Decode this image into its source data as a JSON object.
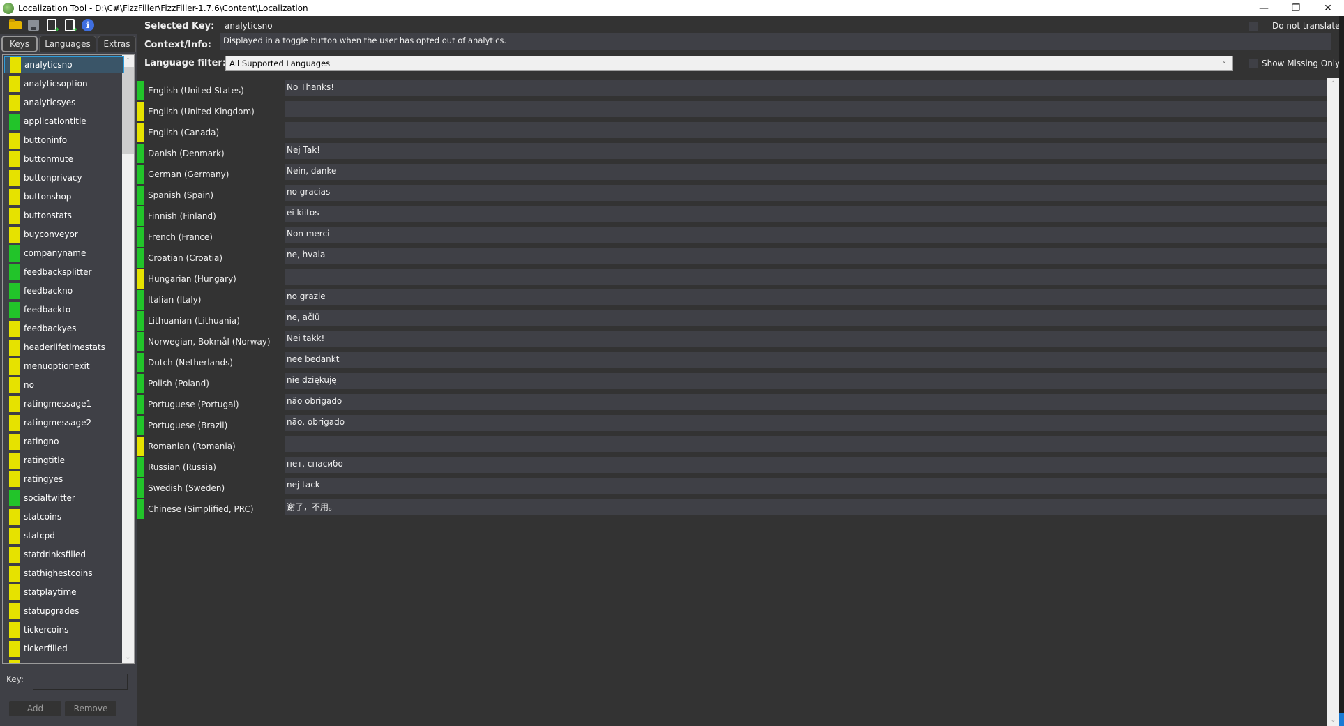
{
  "window": {
    "title": "Localization Tool - D:\\C#\\FizzFiller\\FizzFiller-1.7.6\\Content\\Localization",
    "minimize": "—",
    "maximize": "❐",
    "close": "✕"
  },
  "toolbar": {
    "icons": [
      "folder-open-icon",
      "save-icon",
      "import-file-icon",
      "export-file-icon",
      "info-icon"
    ],
    "info_glyph": "i"
  },
  "tabs": [
    {
      "label": "Keys",
      "active": true
    },
    {
      "label": "Languages",
      "active": false
    },
    {
      "label": "Extras",
      "active": false
    }
  ],
  "colors": {
    "complete": "#22c42a",
    "missing": "#e6e200",
    "selected_bg": "#3a5568",
    "selected_border": "#2e9bd8"
  },
  "keys": [
    {
      "name": "analyticsno",
      "status": "missing",
      "selected": true
    },
    {
      "name": "analyticsoption",
      "status": "missing"
    },
    {
      "name": "analyticsyes",
      "status": "missing"
    },
    {
      "name": "applicationtitle",
      "status": "complete"
    },
    {
      "name": "buttoninfo",
      "status": "missing"
    },
    {
      "name": "buttonmute",
      "status": "missing"
    },
    {
      "name": "buttonprivacy",
      "status": "missing"
    },
    {
      "name": "buttonshop",
      "status": "missing"
    },
    {
      "name": "buttonstats",
      "status": "missing"
    },
    {
      "name": "buyconveyor",
      "status": "missing"
    },
    {
      "name": "companyname",
      "status": "complete"
    },
    {
      "name": "feedbacksplitter",
      "status": "complete"
    },
    {
      "name": "feedbackno",
      "status": "complete"
    },
    {
      "name": "feedbackto",
      "status": "complete"
    },
    {
      "name": "feedbackyes",
      "status": "missing"
    },
    {
      "name": "headerlifetimestats",
      "status": "missing"
    },
    {
      "name": "menuoptionexit",
      "status": "missing"
    },
    {
      "name": "no",
      "status": "missing"
    },
    {
      "name": "ratingmessage1",
      "status": "missing"
    },
    {
      "name": "ratingmessage2",
      "status": "missing"
    },
    {
      "name": "ratingno",
      "status": "missing"
    },
    {
      "name": "ratingtitle",
      "status": "missing"
    },
    {
      "name": "ratingyes",
      "status": "missing"
    },
    {
      "name": "socialtwitter",
      "status": "complete"
    },
    {
      "name": "statcoins",
      "status": "missing"
    },
    {
      "name": "statcpd",
      "status": "missing"
    },
    {
      "name": "statdrinksfilled",
      "status": "missing"
    },
    {
      "name": "stathighestcoins",
      "status": "missing"
    },
    {
      "name": "statplaytime",
      "status": "missing"
    },
    {
      "name": "statupgrades",
      "status": "missing"
    },
    {
      "name": "tickercoins",
      "status": "missing"
    },
    {
      "name": "tickerfilled",
      "status": "missing"
    },
    {
      "name": "",
      "status": "missing"
    }
  ],
  "key_form": {
    "label": "Key:",
    "value": "",
    "add": "Add",
    "remove": "Remove"
  },
  "header": {
    "selected_key_label": "Selected Key:",
    "selected_key_value": "analyticsno",
    "context_label": "Context/Info:",
    "context_value": "Displayed in a toggle button when the user has opted out of analytics.",
    "filter_label": "Language filter:",
    "filter_value": "All Supported Languages",
    "do_not_translate": "Do not translate",
    "do_not_translate_checked": false,
    "show_missing_only": "Show Missing Only",
    "show_missing_only_checked": false
  },
  "translations": [
    {
      "language": "English (United States)",
      "value": "No Thanks!",
      "status": "complete"
    },
    {
      "language": "English (United Kingdom)",
      "value": "",
      "status": "missing"
    },
    {
      "language": "English (Canada)",
      "value": "",
      "status": "missing"
    },
    {
      "language": "Danish (Denmark)",
      "value": "Nej Tak!",
      "status": "complete"
    },
    {
      "language": "German (Germany)",
      "value": "Nein, danke",
      "status": "complete"
    },
    {
      "language": "Spanish (Spain)",
      "value": "no gracias",
      "status": "complete"
    },
    {
      "language": "Finnish (Finland)",
      "value": "ei kiitos",
      "status": "complete"
    },
    {
      "language": "French (France)",
      "value": "Non merci",
      "status": "complete"
    },
    {
      "language": "Croatian (Croatia)",
      "value": "ne, hvala",
      "status": "complete"
    },
    {
      "language": "Hungarian (Hungary)",
      "value": "",
      "status": "missing"
    },
    {
      "language": "Italian (Italy)",
      "value": "no grazie",
      "status": "complete"
    },
    {
      "language": "Lithuanian (Lithuania)",
      "value": "ne, ačiū",
      "status": "complete"
    },
    {
      "language": "Norwegian, Bokmål (Norway)",
      "value": "Nei takk!",
      "status": "complete"
    },
    {
      "language": "Dutch (Netherlands)",
      "value": "nee bedankt",
      "status": "complete"
    },
    {
      "language": "Polish (Poland)",
      "value": "nie dziękuję",
      "status": "complete"
    },
    {
      "language": "Portuguese (Portugal)",
      "value": "não obrigado",
      "status": "complete"
    },
    {
      "language": "Portuguese (Brazil)",
      "value": "não, obrigado",
      "status": "complete"
    },
    {
      "language": "Romanian (Romania)",
      "value": "",
      "status": "missing"
    },
    {
      "language": "Russian (Russia)",
      "value": "нет, спасибо",
      "status": "complete"
    },
    {
      "language": "Swedish (Sweden)",
      "value": "nej tack",
      "status": "complete"
    },
    {
      "language": "Chinese (Simplified, PRC)",
      "value": "谢了，不用。",
      "status": "complete"
    }
  ],
  "scroll": {
    "up": "⌃",
    "down": "⌄"
  }
}
